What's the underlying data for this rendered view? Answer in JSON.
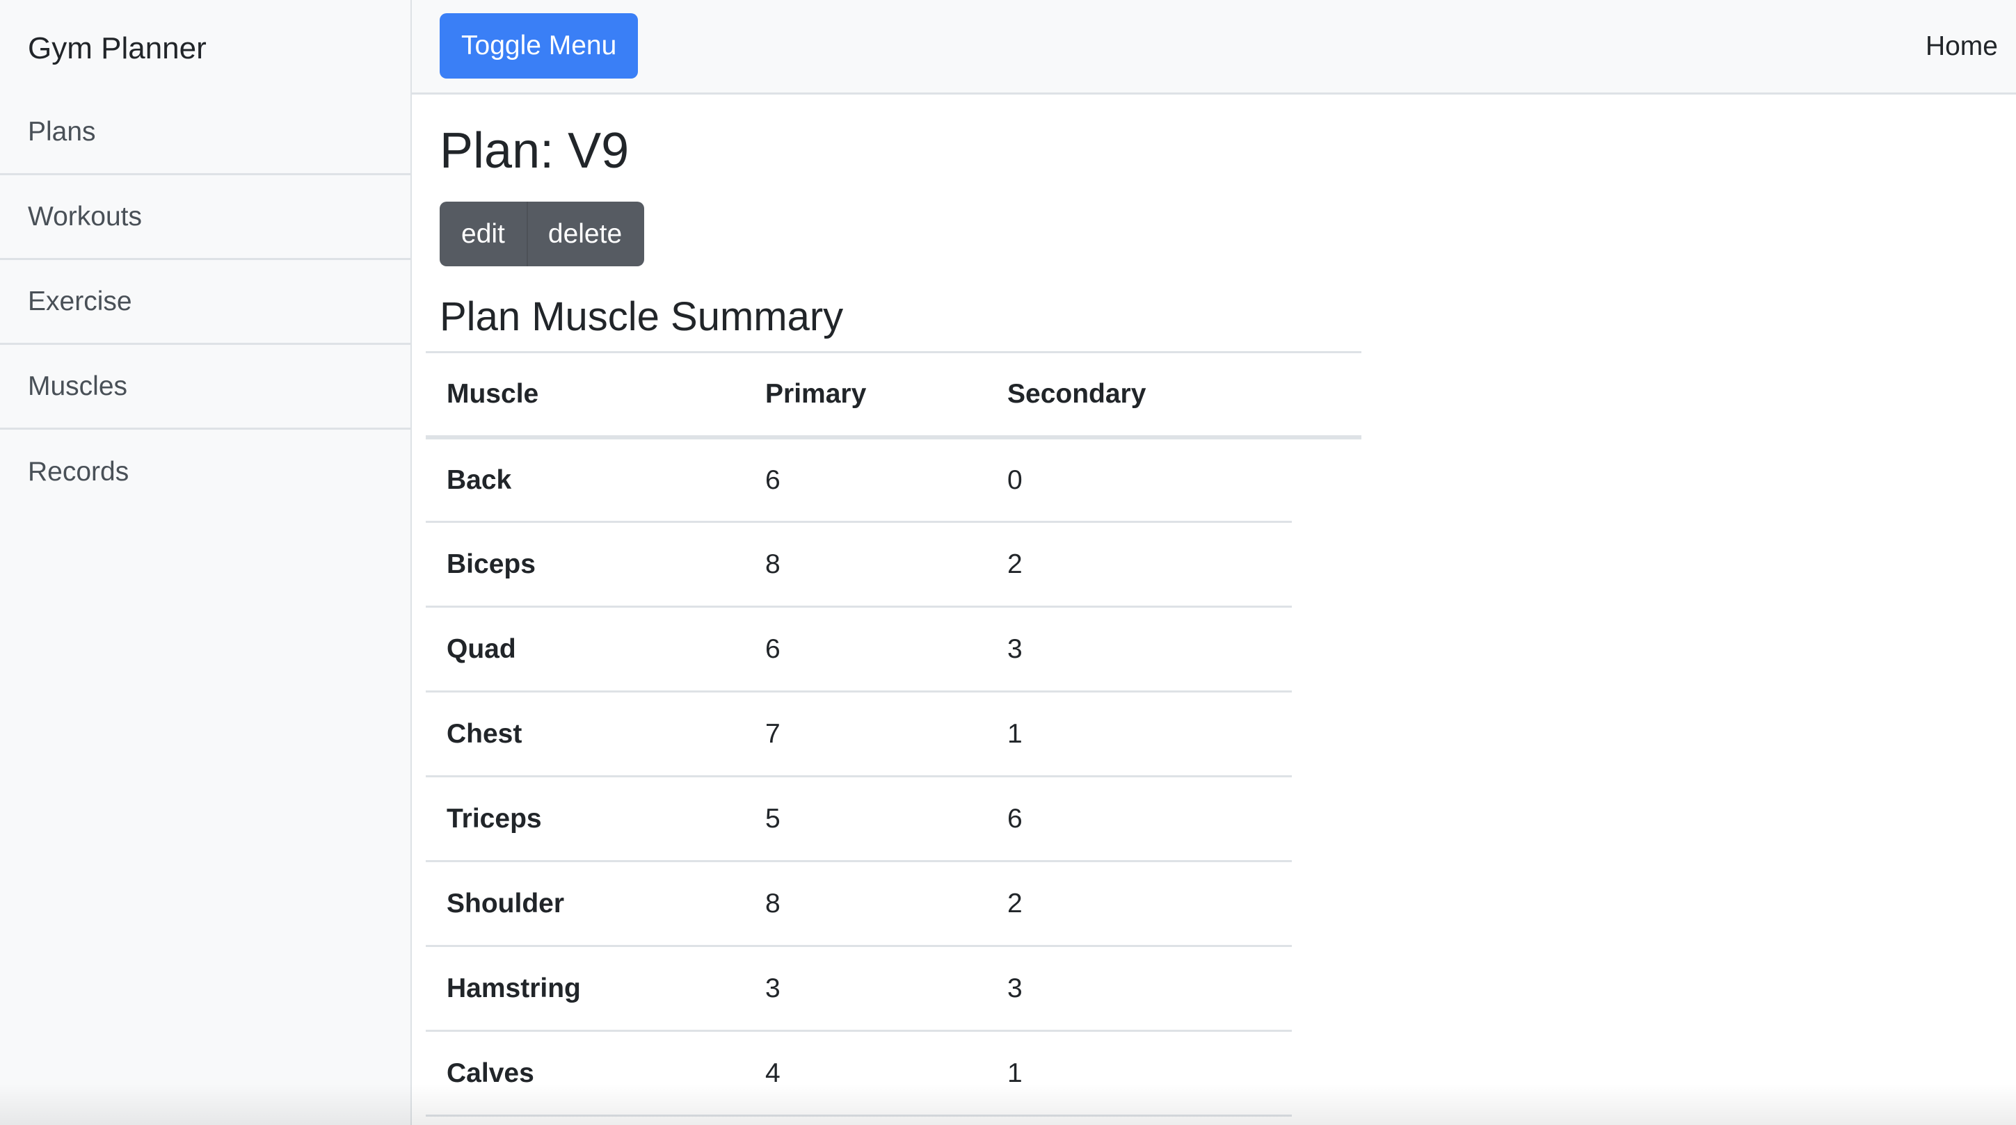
{
  "sidebar": {
    "brand": "Gym Planner",
    "items": [
      {
        "label": "Plans"
      },
      {
        "label": "Workouts"
      },
      {
        "label": "Exercise"
      },
      {
        "label": "Muscles"
      },
      {
        "label": "Records"
      }
    ]
  },
  "navbar": {
    "toggle_label": "Toggle Menu",
    "home_label": "Home"
  },
  "plan": {
    "title": "Plan: V9",
    "edit_label": "edit",
    "delete_label": "delete"
  },
  "summary": {
    "title": "Plan Muscle Summary",
    "columns": [
      "Muscle",
      "Primary",
      "Secondary"
    ],
    "rows": [
      {
        "muscle": "Back",
        "primary": "6",
        "secondary": "0"
      },
      {
        "muscle": "Biceps",
        "primary": "8",
        "secondary": "2"
      },
      {
        "muscle": "Quad",
        "primary": "6",
        "secondary": "3"
      },
      {
        "muscle": "Chest",
        "primary": "7",
        "secondary": "1"
      },
      {
        "muscle": "Triceps",
        "primary": "5",
        "secondary": "6"
      },
      {
        "muscle": "Shoulder",
        "primary": "8",
        "secondary": "2"
      },
      {
        "muscle": "Hamstring",
        "primary": "3",
        "secondary": "3"
      },
      {
        "muscle": "Calves",
        "primary": "4",
        "secondary": "1"
      }
    ]
  },
  "colors": {
    "primary": "#3a7ff6",
    "secondary": "#565b62",
    "sidebar_bg": "#f8f9fa",
    "border": "#dee2e6"
  }
}
